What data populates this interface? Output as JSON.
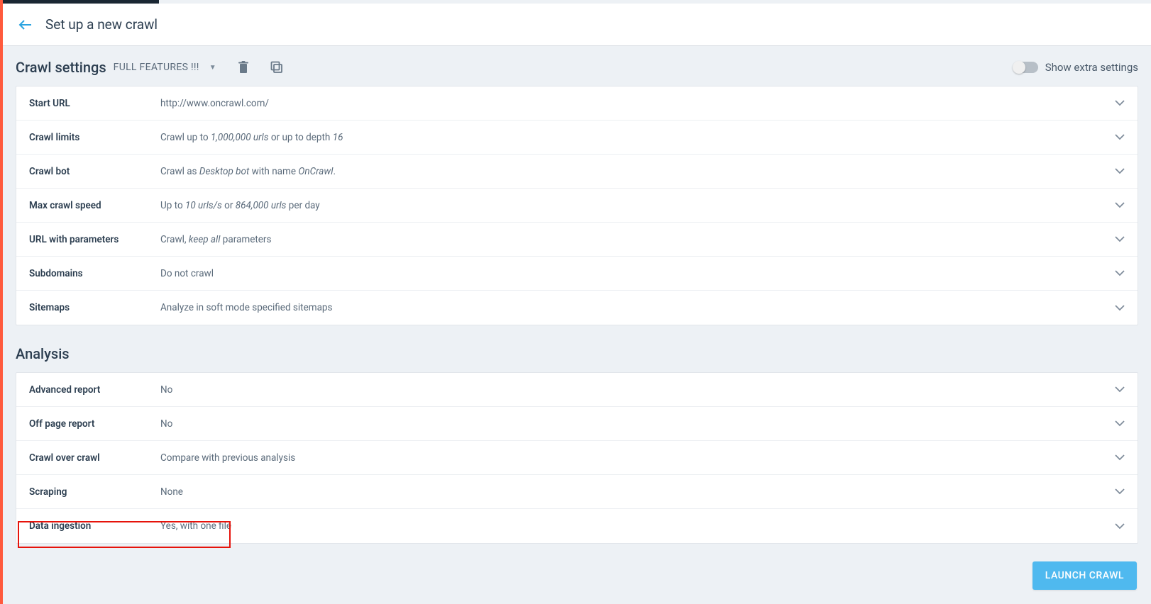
{
  "header": {
    "title": "Set up a new crawl"
  },
  "toolbar": {
    "title": "Crawl settings",
    "dropdown_label": "FULL FEATURES !!!",
    "toggle_label": "Show extra settings"
  },
  "crawl_settings": [
    {
      "label": "Start URL",
      "value_html": "http://www.oncrawl.com/"
    },
    {
      "label": "Crawl limits",
      "value_html": "Crawl up to <em>1,000,000 urls</em> or up to depth <em>16</em>"
    },
    {
      "label": "Crawl bot",
      "value_html": "Crawl as <em>Desktop bot</em> with name <em>OnCrawl</em>."
    },
    {
      "label": "Max crawl speed",
      "value_html": "Up to <em>10 urls/s</em> or <em>864,000 urls</em> per day"
    },
    {
      "label": "URL with parameters",
      "value_html": "Crawl, <em>keep all</em> parameters"
    },
    {
      "label": "Subdomains",
      "value_html": "Do not crawl"
    },
    {
      "label": "Sitemaps",
      "value_html": "Analyze in soft mode specified sitemaps"
    }
  ],
  "analysis_title": "Analysis",
  "analysis_settings": [
    {
      "label": "Advanced report",
      "value_html": "No"
    },
    {
      "label": "Off page report",
      "value_html": "No"
    },
    {
      "label": "Crawl over crawl",
      "value_html": "Compare with previous analysis"
    },
    {
      "label": "Scraping",
      "value_html": "None"
    },
    {
      "label": "Data ingestion",
      "value_html": "Yes, with one file"
    }
  ],
  "launch_label": "LAUNCH CRAWL"
}
